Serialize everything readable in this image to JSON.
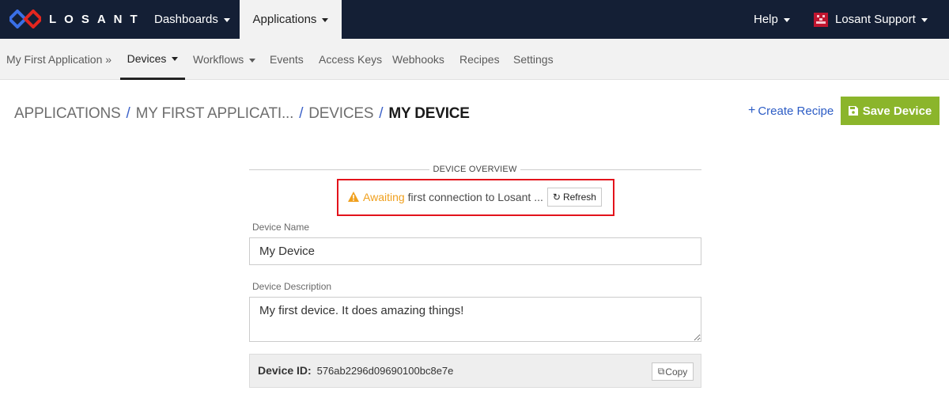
{
  "topnav": {
    "logo_text": "LOSANT",
    "dashboards": "Dashboards",
    "applications": "Applications",
    "help": "Help",
    "user": "Losant Support"
  },
  "subnav": {
    "app": "My First Application »",
    "devices": "Devices",
    "workflows": "Workflows",
    "events": "Events",
    "access_keys": "Access Keys",
    "webhooks": "Webhooks",
    "recipes": "Recipes",
    "settings": "Settings"
  },
  "breadcrumb": {
    "applications": "APPLICATIONS",
    "app": "MY FIRST APPLICATI...",
    "devices": "DEVICES",
    "current": "MY DEVICE",
    "separator": "/"
  },
  "actions": {
    "create_recipe": "Create Recipe",
    "create_recipe_plus": "+",
    "save_device": "Save Device"
  },
  "overview": {
    "title": "DEVICE OVERVIEW",
    "status_awaiting": "Awaiting",
    "status_rest": "first connection to Losant ...",
    "refresh": "Refresh"
  },
  "form": {
    "name_label": "Device Name",
    "name_value": "My Device",
    "desc_label": "Device Description",
    "desc_value": "My first device. It does amazing things!",
    "device_id_label": "Device ID:",
    "device_id_value": "576ab2296d09690100bc8e7e",
    "copy": "Copy"
  },
  "colors": {
    "topnav_bg": "#141f35",
    "save_green": "#8bb52b",
    "link_blue": "#2c5cc5",
    "warning_orange": "#f0a01e",
    "highlight_red": "#e3131b"
  }
}
